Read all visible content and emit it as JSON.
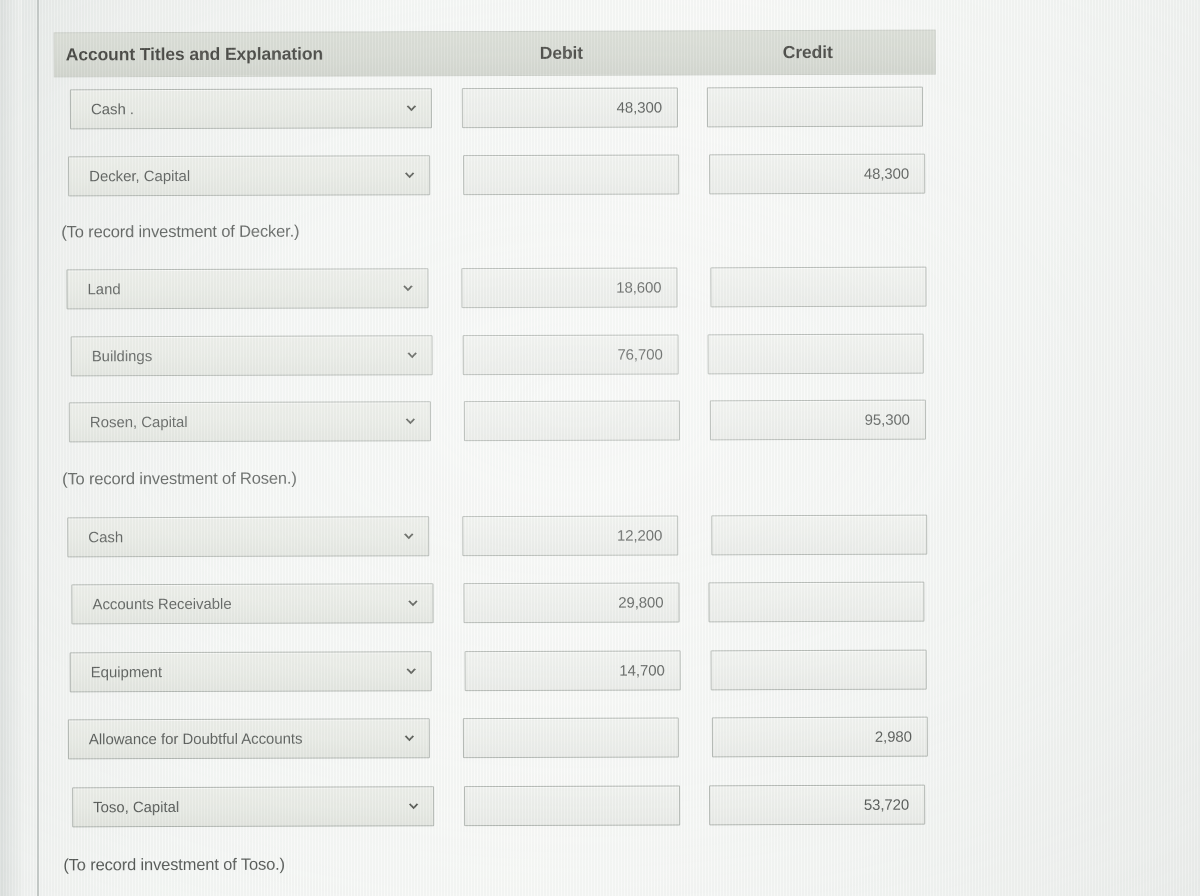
{
  "table": {
    "columns": {
      "account": "Account Titles and Explanation",
      "debit": "Debit",
      "credit": "Credit"
    },
    "rows": [
      {
        "kind": "entry",
        "account": "Cash .",
        "debit": "48,300",
        "credit": ""
      },
      {
        "kind": "entry",
        "account": "Decker, Capital",
        "debit": "",
        "credit": "48,300"
      },
      {
        "kind": "note",
        "text": "(To record investment of Decker.)"
      },
      {
        "kind": "entry",
        "account": "Land",
        "debit": "18,600",
        "credit": ""
      },
      {
        "kind": "entry",
        "account": "Buildings",
        "debit": "76,700",
        "credit": ""
      },
      {
        "kind": "entry",
        "account": "Rosen, Capital",
        "debit": "",
        "credit": "95,300"
      },
      {
        "kind": "note",
        "text": "(To record investment of Rosen.)"
      },
      {
        "kind": "entry",
        "account": "Cash",
        "debit": "12,200",
        "credit": ""
      },
      {
        "kind": "entry",
        "account": "Accounts Receivable",
        "debit": "29,800",
        "credit": ""
      },
      {
        "kind": "entry",
        "account": "Equipment",
        "debit": "14,700",
        "credit": ""
      },
      {
        "kind": "entry",
        "account": "Allowance for Doubtful Accounts",
        "debit": "",
        "credit": "2,980"
      },
      {
        "kind": "entry",
        "account": "Toso, Capital",
        "debit": "",
        "credit": "53,720"
      },
      {
        "kind": "note",
        "text": "(To record investment of Toso.)"
      }
    ]
  },
  "icons": {
    "dropdown": "chevron-down-icon"
  },
  "colors": {
    "header_bar": "#cdd1c8",
    "page_background": "#f4f6f4",
    "field_border": "#9aa09a",
    "text": "#2b2f2c"
  }
}
